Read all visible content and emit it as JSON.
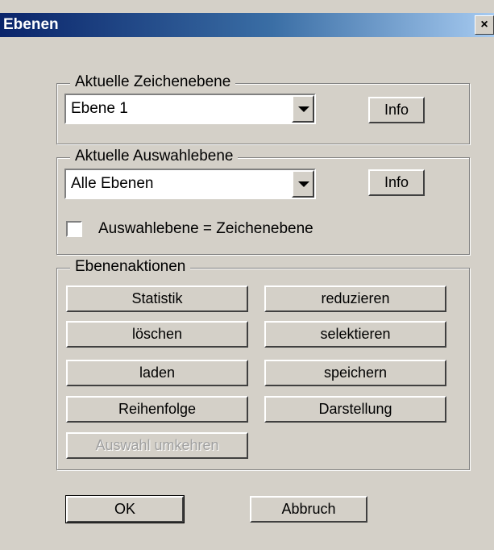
{
  "window": {
    "title": "Ebenen",
    "close_symbol": "×"
  },
  "drawing_layer": {
    "group_label": "Aktuelle Zeichenebene",
    "selected": "Ebene  1",
    "info_label": "Info"
  },
  "selection_layer": {
    "group_label": "Aktuelle Auswahlebene",
    "selected": "Alle Ebenen",
    "info_label": "Info",
    "checkbox_label": "Auswahlebene = Zeichenebene",
    "checkbox_checked": false
  },
  "actions": {
    "group_label": "Ebenenaktionen",
    "statistik": "Statistik",
    "reduzieren": "reduzieren",
    "loeschen": "löschen",
    "selektieren": "selektieren",
    "laden": "laden",
    "speichern": "speichern",
    "reihenfolge": "Reihenfolge",
    "darstellung": "Darstellung",
    "auswahl_umkehren": "Auswahl umkehren"
  },
  "footer": {
    "ok_label": "OK",
    "cancel_label": "Abbruch"
  }
}
